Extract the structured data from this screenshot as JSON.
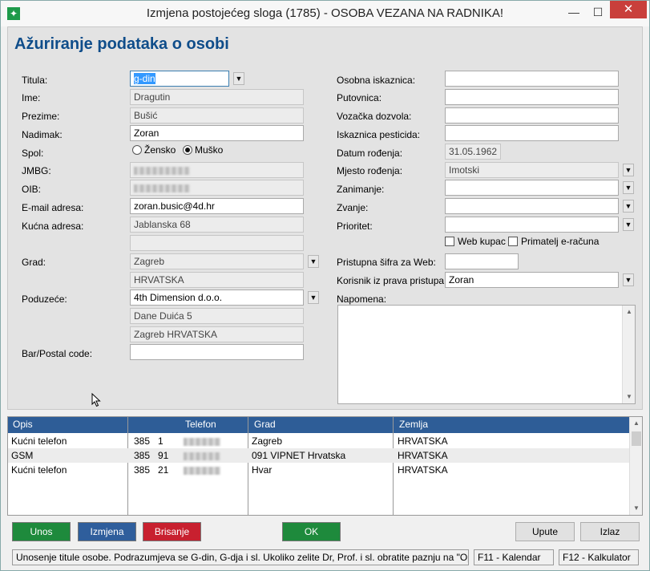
{
  "window": {
    "title": "Izmjena postojećeg sloga (1785) - OSOBA VEZANA NA RADNIKA!",
    "minimize": "—",
    "maximize": "☐",
    "close": "✕"
  },
  "heading": "Ažuriranje podataka o osobi",
  "left": {
    "titula_label": "Titula:",
    "titula_value": "g-din",
    "ime_label": "Ime:",
    "ime_value": "Dragutin",
    "prezime_label": "Prezime:",
    "prezime_value": "Bušić",
    "nadimak_label": "Nadimak:",
    "nadimak_value": "Zoran",
    "spol_label": "Spol:",
    "spol_f": "Žensko",
    "spol_m": "Muško",
    "jmbg_label": "JMBG:",
    "oib_label": "OIB:",
    "email_label": "E-mail adresa:",
    "email_value": "zoran.busic@4d.hr",
    "adresa_label": "Kućna adresa:",
    "adresa_value": "Jablanska 68",
    "grad_label": "Grad:",
    "grad_value": "Zagreb",
    "drzava_value": "HRVATSKA",
    "poduzece_label": "Poduzeće:",
    "poduzece_value": "4th Dimension d.o.o.",
    "poduzece_adresa": "Dane Duića 5",
    "poduzece_grad": "Zagreb HRVATSKA",
    "postal_label": "Bar/Postal code:"
  },
  "right": {
    "osobna_label": "Osobna iskaznica:",
    "putovnica_label": "Putovnica:",
    "vozacka_label": "Vozačka dozvola:",
    "pesticida_label": "Iskaznica pesticida:",
    "datum_label": "Datum rođenja:",
    "datum_value": "31.05.1962",
    "mjesto_label": "Mjesto rođenja:",
    "mjesto_value": "Imotski",
    "zanimanje_label": "Zanimanje:",
    "zvanje_label": "Zvanje:",
    "prioritet_label": "Prioritet:",
    "web_kupac": "Web kupac",
    "primatelj": "Primatelj e-računa",
    "sifra_label": "Pristupna šifra za Web:",
    "korisnik_label": "Korisnik iz prava pristupa:",
    "korisnik_value": "Zoran",
    "napomena_label": "Napomena:"
  },
  "grid": {
    "columns": [
      "Opis",
      "Telefon",
      "Grad",
      "Zemlja"
    ],
    "rows": [
      {
        "opis": "Kućni telefon",
        "cc": "385",
        "area": "1",
        "grad": "Zagreb",
        "zemlja": "HRVATSKA"
      },
      {
        "opis": "GSM",
        "cc": "385",
        "area": "91",
        "grad": "091 VIPNET Hrvatska",
        "zemlja": "HRVATSKA"
      },
      {
        "opis": "Kućni telefon",
        "cc": "385",
        "area": "21",
        "grad": "Hvar",
        "zemlja": "HRVATSKA"
      }
    ]
  },
  "buttons": {
    "unos": "Unos",
    "izmjena": "Izmjena",
    "brisanje": "Brisanje",
    "ok": "OK",
    "upute": "Upute",
    "izlaz": "Izlaz"
  },
  "status": {
    "hint": "Unosenje titule osobe. Podrazumjeva se G-din, G-dja i sl. Ukoliko zelite Dr, Prof. i sl. obratite paznju na \"Opis",
    "f11": "F11 - Kalendar",
    "f12": "F12 - Kalkulator"
  },
  "colors": {
    "heading": "#0f4d8a",
    "grid_header": "#2e5d97",
    "green": "#1e8a3c",
    "blue": "#2f5e9c",
    "red": "#c8202f"
  }
}
